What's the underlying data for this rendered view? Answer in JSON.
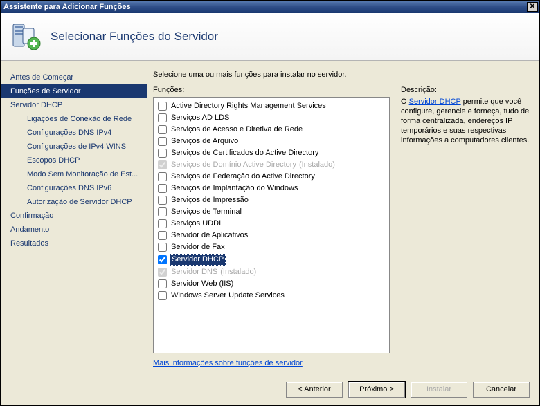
{
  "window": {
    "title": "Assistente para Adicionar Funções"
  },
  "header": {
    "title": "Selecionar Funções do Servidor"
  },
  "sidebar": {
    "items": [
      {
        "label": "Antes de Começar",
        "indent": false,
        "active": false
      },
      {
        "label": "Funções de Servidor",
        "indent": false,
        "active": true
      },
      {
        "label": "Servidor DHCP",
        "indent": false,
        "active": false
      },
      {
        "label": "Ligações de Conexão de Rede",
        "indent": true,
        "active": false
      },
      {
        "label": "Configurações DNS IPv4",
        "indent": true,
        "active": false
      },
      {
        "label": "Configurações de IPv4 WINS",
        "indent": true,
        "active": false
      },
      {
        "label": "Escopos DHCP",
        "indent": true,
        "active": false
      },
      {
        "label": "Modo Sem Monitoração de Est...",
        "indent": true,
        "active": false
      },
      {
        "label": "Configurações DNS IPv6",
        "indent": true,
        "active": false
      },
      {
        "label": "Autorização de Servidor DHCP",
        "indent": true,
        "active": false
      },
      {
        "label": "Confirmação",
        "indent": false,
        "active": false
      },
      {
        "label": "Andamento",
        "indent": false,
        "active": false
      },
      {
        "label": "Resultados",
        "indent": false,
        "active": false
      }
    ]
  },
  "content": {
    "instruction": "Selecione uma ou mais funções para instalar no servidor.",
    "roles_label": "Funções:",
    "desc_label": "Descrição:",
    "installed_suffix": "(Instalado)",
    "roles": [
      {
        "label": "Active Directory Rights Management Services",
        "checked": false,
        "disabled": false,
        "installed": false,
        "selected": false
      },
      {
        "label": "Serviços AD LDS",
        "checked": false,
        "disabled": false,
        "installed": false,
        "selected": false
      },
      {
        "label": "Serviços de Acesso e Diretiva de Rede",
        "checked": false,
        "disabled": false,
        "installed": false,
        "selected": false
      },
      {
        "label": "Serviços de Arquivo",
        "checked": false,
        "disabled": false,
        "installed": false,
        "selected": false
      },
      {
        "label": "Serviços de Certificados do Active Directory",
        "checked": false,
        "disabled": false,
        "installed": false,
        "selected": false
      },
      {
        "label": "Serviços de Domínio Active Directory",
        "checked": true,
        "disabled": true,
        "installed": true,
        "selected": false
      },
      {
        "label": "Serviços de Federação do Active Directory",
        "checked": false,
        "disabled": false,
        "installed": false,
        "selected": false
      },
      {
        "label": "Serviços de Implantação do Windows",
        "checked": false,
        "disabled": false,
        "installed": false,
        "selected": false
      },
      {
        "label": "Serviços de Impressão",
        "checked": false,
        "disabled": false,
        "installed": false,
        "selected": false
      },
      {
        "label": "Serviços de Terminal",
        "checked": false,
        "disabled": false,
        "installed": false,
        "selected": false
      },
      {
        "label": "Serviços UDDI",
        "checked": false,
        "disabled": false,
        "installed": false,
        "selected": false
      },
      {
        "label": "Servidor de Aplicativos",
        "checked": false,
        "disabled": false,
        "installed": false,
        "selected": false
      },
      {
        "label": "Servidor de Fax",
        "checked": false,
        "disabled": false,
        "installed": false,
        "selected": false
      },
      {
        "label": "Servidor DHCP",
        "checked": true,
        "disabled": false,
        "installed": false,
        "selected": true
      },
      {
        "label": "Servidor DNS",
        "checked": true,
        "disabled": true,
        "installed": true,
        "selected": false
      },
      {
        "label": "Servidor Web (IIS)",
        "checked": false,
        "disabled": false,
        "installed": false,
        "selected": false
      },
      {
        "label": "Windows Server Update Services",
        "checked": false,
        "disabled": false,
        "installed": false,
        "selected": false
      }
    ],
    "description": {
      "prefix": "O ",
      "link": "Servidor DHCP",
      "suffix": " permite que você configure, gerencie e forneça, tudo de forma centralizada, endereços IP temporários e suas respectivas informações a computadores clientes."
    },
    "more_info": "Mais informações sobre funções de servidor"
  },
  "footer": {
    "back": "< Anterior",
    "next": "Próximo >",
    "install": "Instalar",
    "cancel": "Cancelar"
  }
}
